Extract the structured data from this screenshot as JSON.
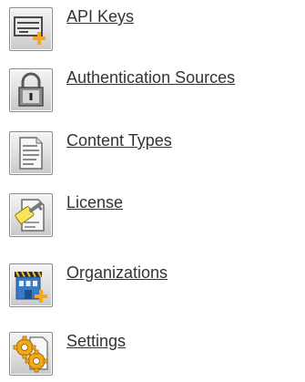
{
  "menu": {
    "items": [
      {
        "label": "API Keys",
        "icon": "api-keys-icon"
      },
      {
        "label": "Authentication Sources",
        "icon": "lock-icon"
      },
      {
        "label": "Content Types",
        "icon": "document-icon"
      },
      {
        "label": "License",
        "icon": "license-icon"
      },
      {
        "label": "Organizations",
        "icon": "building-icon"
      },
      {
        "label": "Settings",
        "icon": "gears-icon"
      }
    ]
  },
  "colors": {
    "link_text": "#333333",
    "icon_border": "#8a8a8a",
    "accent_orange": "#f2a81d"
  }
}
